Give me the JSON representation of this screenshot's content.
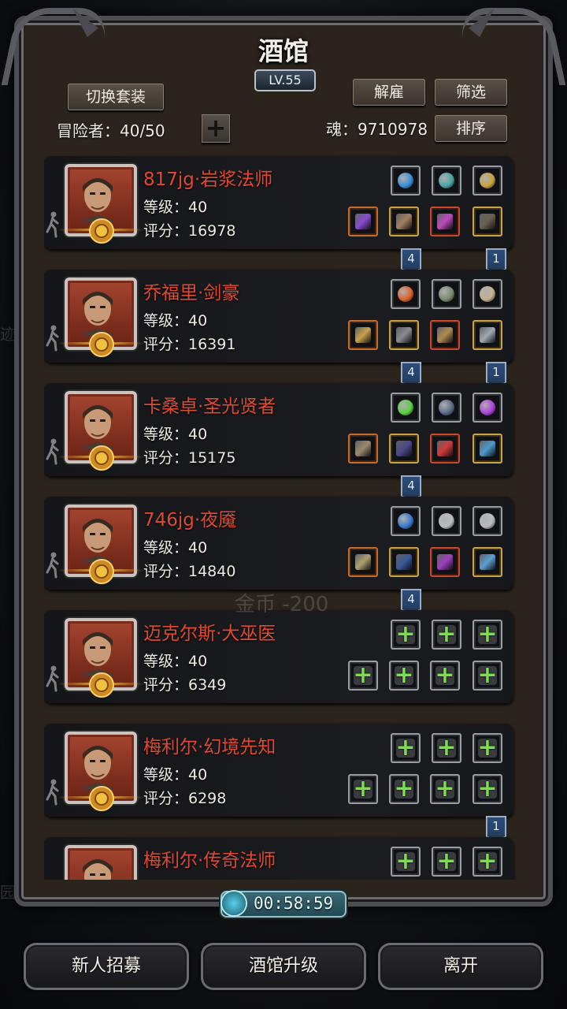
{
  "header": {
    "title": "酒馆",
    "level": "LV.55"
  },
  "toolbar": {
    "switch_set_label": "切换套装",
    "dismiss_label": "解雇",
    "filter_label": "筛选",
    "sort_label": "排序",
    "adventurers_label": "冒险者：40/50",
    "soul_label": "魂：9710978"
  },
  "heroes": [
    {
      "name": "817jg·岩浆法师",
      "level": "等级：40",
      "score": "评分：16978",
      "top_slots": [
        "blue-orb-icon",
        "teal-gem-icon",
        "lantern-icon"
      ],
      "bottom_slots": [
        "staff-icon",
        "armor-icon",
        "amulet-icon",
        "boots-icon"
      ],
      "ribbons": [
        "4",
        "1"
      ]
    },
    {
      "name": "乔福里·剑豪",
      "level": "等级：40",
      "score": "评分：16391",
      "top_slots": [
        "flame-icon",
        "hammer-icon",
        "horn-icon"
      ],
      "bottom_slots": [
        "sword-icon",
        "chestplate-icon",
        "scroll-icon",
        "helmet-icon"
      ],
      "ribbons": [
        "4",
        "1"
      ]
    },
    {
      "name": "卡桑卓·圣光贤者",
      "level": "等级：40",
      "score": "评分：15175",
      "top_slots": [
        "green-crystal-icon",
        "triangle-rune-icon",
        "purple-gem-icon"
      ],
      "bottom_slots": [
        "mace-icon",
        "robe-icon",
        "potion-icon",
        "pendant-icon"
      ],
      "ribbons": [
        "4"
      ]
    },
    {
      "name": "746jg·夜魇",
      "level": "等级：40",
      "score": "评分：14840",
      "top_slots": [
        "blue-swirl-icon",
        "grey-stone-icon",
        "grey-stone-icon"
      ],
      "bottom_slots": [
        "spear-icon",
        "blue-armor-icon",
        "purple-claw-icon",
        "ring-icon"
      ],
      "ribbons": [
        "4"
      ]
    },
    {
      "name": "迈克尔斯·大巫医",
      "level": "等级：40",
      "score": "评分：6349",
      "top_slots": [
        "add-icon",
        "add-icon",
        "add-icon"
      ],
      "bottom_slots": [
        "add-icon",
        "add-icon",
        "add-icon",
        "add-icon"
      ],
      "ribbons": []
    },
    {
      "name": "梅利尔·幻境先知",
      "level": "等级：40",
      "score": "评分：6298",
      "top_slots": [
        "add-icon",
        "add-icon",
        "add-icon"
      ],
      "bottom_slots": [
        "add-icon",
        "add-icon",
        "add-icon",
        "add-icon"
      ],
      "ribbons": [
        "1"
      ]
    },
    {
      "name": "梅利尔·传奇法师",
      "level": "",
      "score": "",
      "top_slots": [
        "add-icon",
        "add-icon",
        "add-icon"
      ],
      "bottom_slots": [],
      "ribbons": []
    }
  ],
  "floating_text": "金币 -200",
  "timer": "00:58:59",
  "bottom_buttons": {
    "recruit": "新人招募",
    "upgrade": "酒馆升级",
    "leave": "离开"
  },
  "colors": {
    "name_red": "#e04a32",
    "plus_green": "#7ae04a",
    "ribbon_blue": "#2d4e7a"
  }
}
